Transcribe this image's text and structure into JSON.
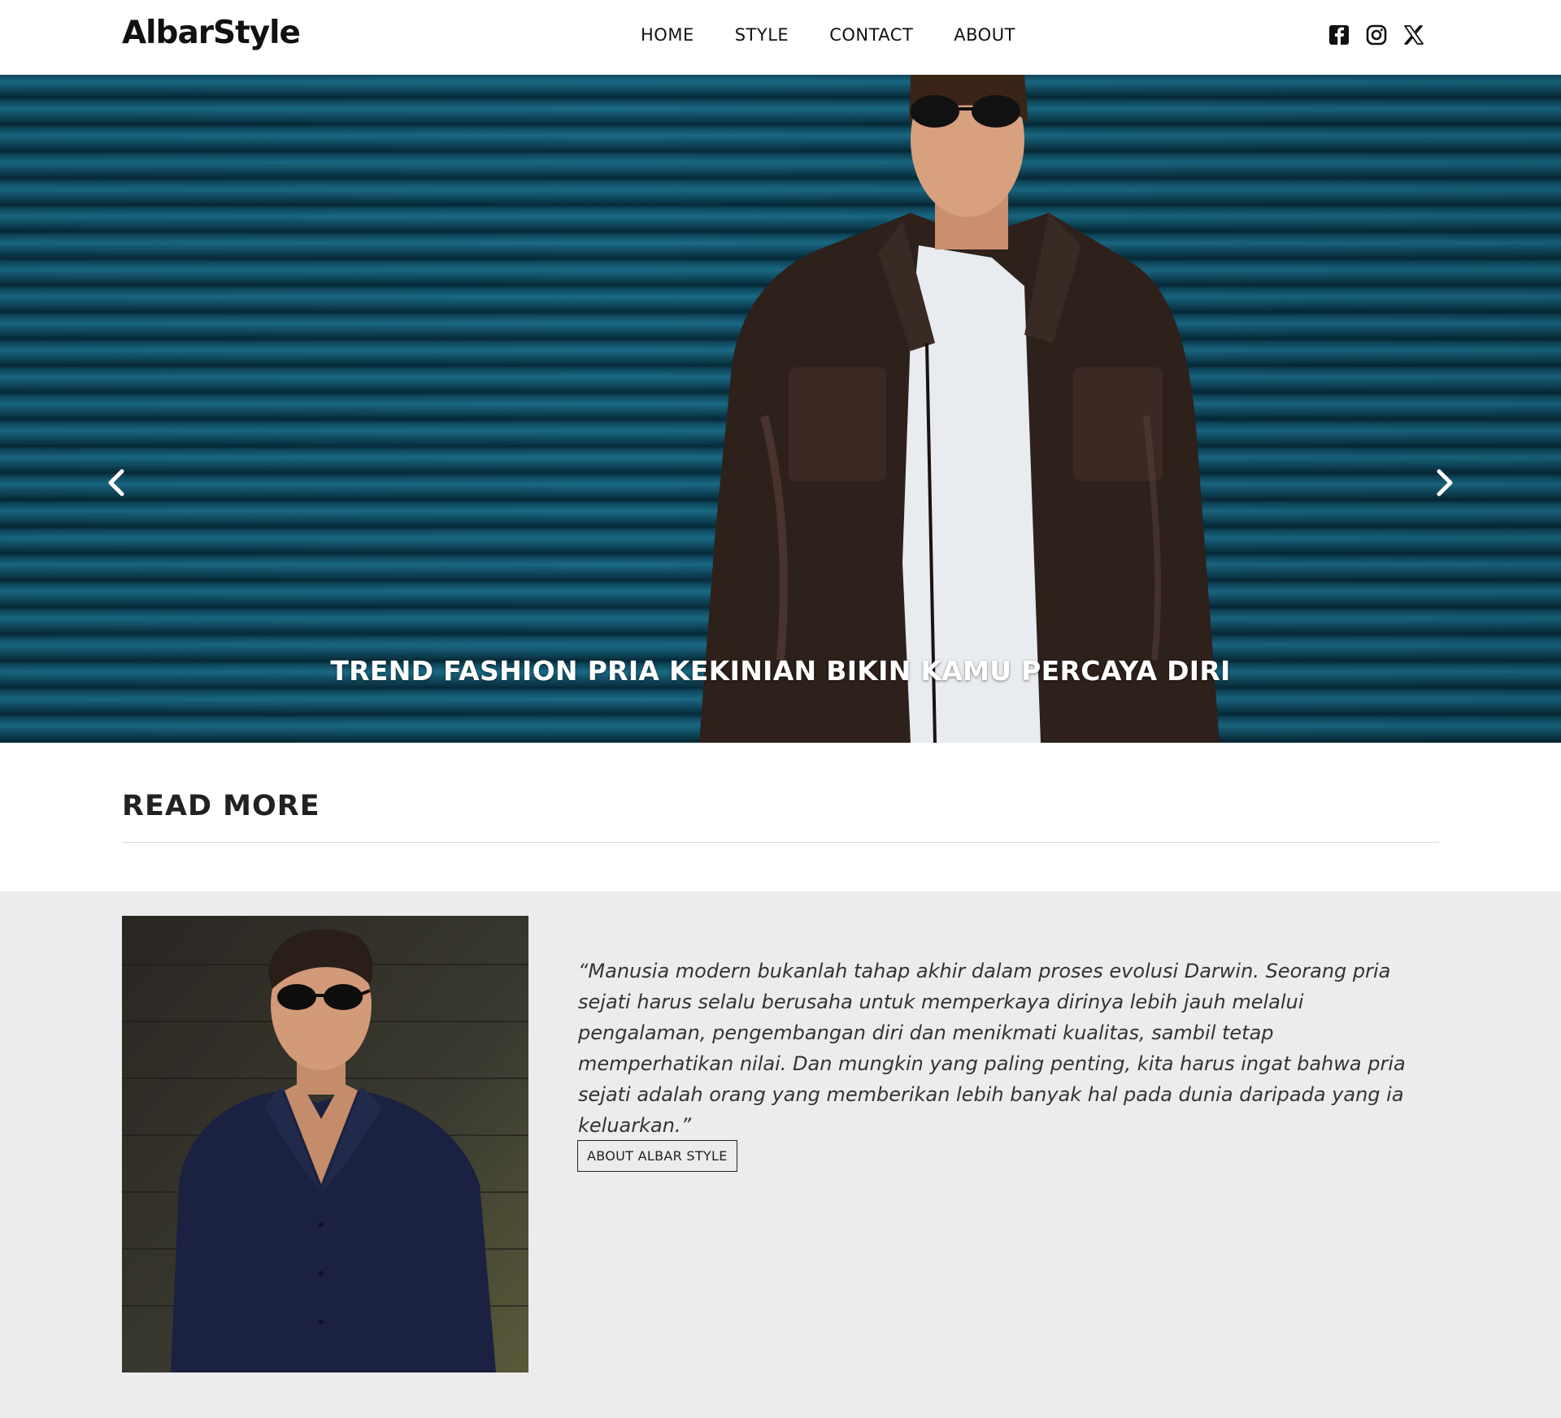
{
  "header": {
    "logo": "AlbarStyle",
    "nav": [
      "HOME",
      "STYLE",
      "CONTACT",
      "ABOUT"
    ],
    "social_icons": [
      "facebook-icon",
      "instagram-icon",
      "x-icon"
    ]
  },
  "hero": {
    "caption": "TREND FASHION PRIA KEKINIAN BIKIN KAMU PERCAYA DIRI",
    "prev_icon": "chevron-left-icon",
    "next_icon": "chevron-right-icon"
  },
  "read_more": {
    "heading": "READ MORE"
  },
  "about": {
    "quote": "“Manusia modern bukanlah tahap akhir dalam proses evolusi Darwin. Seorang pria sejati harus selalu berusaha untuk memperkaya dirinya lebih jauh melalui pengalaman, pengembangan diri dan menikmati kualitas, sambil tetap memperhatikan nilai. Dan mungkin yang paling penting, kita harus ingat bahwa pria sejati adalah orang yang memberikan lebih banyak hal pada dunia daripada yang ia keluarkan.”",
    "button_label": "ABOUT ALBAR STYLE"
  },
  "colors": {
    "hero_background": "#0f4a60",
    "section_background": "#ececec"
  }
}
